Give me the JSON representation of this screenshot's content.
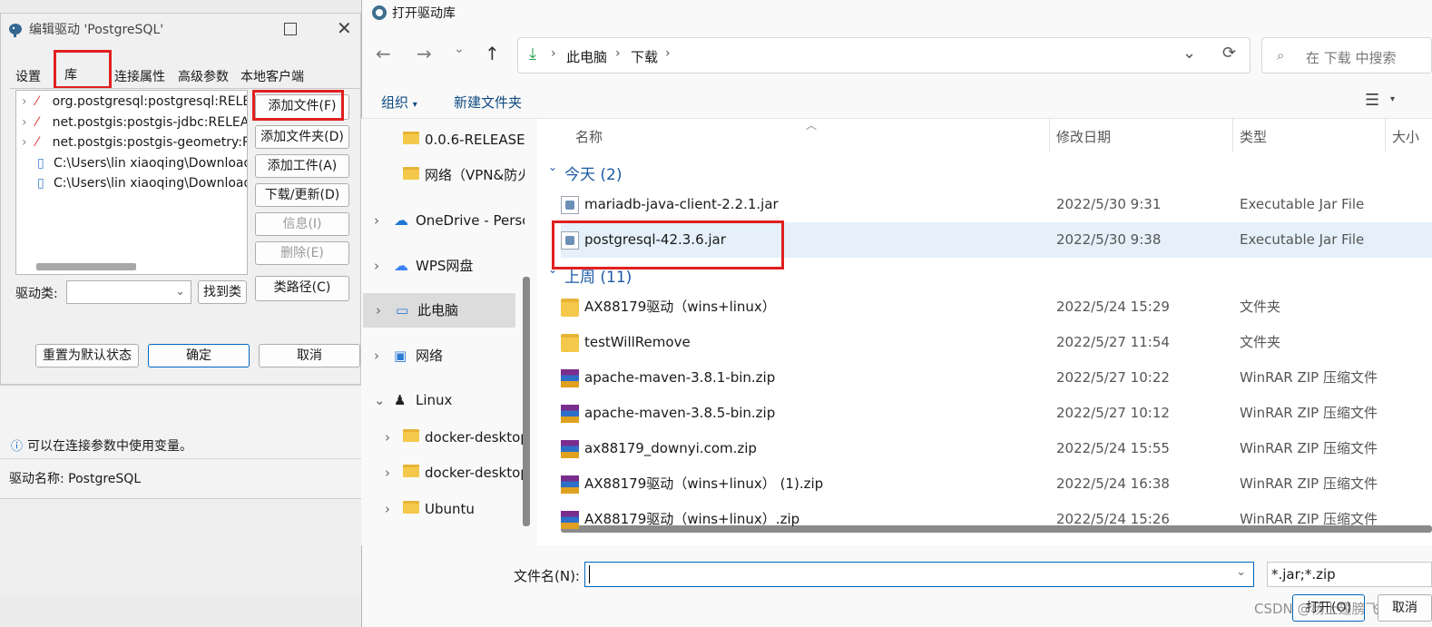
{
  "left": {
    "title": "编辑驱动 'PostgreSQL'",
    "tabs": [
      "设置",
      "库",
      "连接属性",
      "高级参数",
      "本地客户端"
    ],
    "tree": [
      {
        "label": "org.postgresql:postgresql:RELEASE",
        "kind": "maven"
      },
      {
        "label": "net.postgis:postgis-jdbc:RELEASE",
        "kind": "maven"
      },
      {
        "label": "net.postgis:postgis-geometry:RELEASE",
        "kind": "maven"
      },
      {
        "label": "C:\\Users\\lin xiaoqing\\Downloads",
        "kind": "file"
      },
      {
        "label": "C:\\Users\\lin xiaoqing\\Downloads",
        "kind": "file"
      }
    ],
    "buttons": {
      "add_file": "添加文件(F)",
      "add_folder": "添加文件夹(D)",
      "add_artifact": "添加工件(A)",
      "download_update": "下载/更新(D)",
      "info": "信息(I)",
      "delete": "删除(E)",
      "class_path": "类路径(C)",
      "find_class": "找到类",
      "reset_default": "重置为默认状态",
      "ok": "确定",
      "cancel": "取消"
    },
    "driver_class_label": "驱动类:",
    "info_text": "可以在连接参数中使用变量。",
    "driver_name_label": "驱动名称: PostgreSQL"
  },
  "right": {
    "title": "打开驱动库",
    "breadcrumb": [
      "此电脑",
      "下载"
    ],
    "search_placeholder": "在 下载 中搜索",
    "toolbar": {
      "organize": "组织",
      "new_folder": "新建文件夹"
    },
    "nav_items": [
      {
        "label": "0.0.6-RELEASE",
        "icon": "folder",
        "expandable": false
      },
      {
        "label": "网络（VPN&防火墙）",
        "icon": "folder",
        "expandable": false
      },
      {
        "label": "OneDrive - Personal",
        "icon": "onedrive",
        "expandable": true
      },
      {
        "label": "WPS网盘",
        "icon": "cloud",
        "expandable": true
      },
      {
        "label": "此电脑",
        "icon": "computer",
        "expandable": true
      },
      {
        "label": "网络",
        "icon": "network",
        "expandable": true
      },
      {
        "label": "Linux",
        "icon": "linux",
        "expandable": true
      },
      {
        "label": "docker-desktop",
        "icon": "folder",
        "expandable": true
      },
      {
        "label": "docker-desktop-data",
        "icon": "folder",
        "expandable": true
      },
      {
        "label": "Ubuntu",
        "icon": "folder",
        "expandable": true
      }
    ],
    "columns": [
      "名称",
      "修改日期",
      "类型",
      "大小"
    ],
    "group_today": "今天 (2)",
    "group_lastweek": "上周 (11)",
    "files_today": [
      {
        "name": "mariadb-java-client-2.2.1.jar",
        "date": "2022/5/30 9:31",
        "type": "Executable Jar File",
        "icon": "jar"
      },
      {
        "name": "postgresql-42.3.6.jar",
        "date": "2022/5/30 9:38",
        "type": "Executable Jar File",
        "icon": "jar"
      }
    ],
    "files_lastweek": [
      {
        "name": "AX88179驱动（wins+linux）",
        "date": "2022/5/24 15:29",
        "type": "文件夹",
        "icon": "folder"
      },
      {
        "name": "testWillRemove",
        "date": "2022/5/27 11:54",
        "type": "文件夹",
        "icon": "folder"
      },
      {
        "name": "apache-maven-3.8.1-bin.zip",
        "date": "2022/5/27 10:22",
        "type": "WinRAR ZIP 压缩文件",
        "icon": "zip"
      },
      {
        "name": "apache-maven-3.8.5-bin.zip",
        "date": "2022/5/27 10:12",
        "type": "WinRAR ZIP 压缩文件",
        "icon": "zip"
      },
      {
        "name": "ax88179_downyi.com.zip",
        "date": "2022/5/24 15:55",
        "type": "WinRAR ZIP 压缩文件",
        "icon": "zip"
      },
      {
        "name": "AX88179驱动（wins+linux） (1).zip",
        "date": "2022/5/24 16:38",
        "type": "WinRAR ZIP 压缩文件",
        "icon": "zip"
      },
      {
        "name": "AX88179驱动（wins+linux）.zip",
        "date": "2022/5/24 15:26",
        "type": "WinRAR ZIP 压缩文件",
        "icon": "zip"
      }
    ],
    "filename_label": "文件名(N):",
    "filename_value": "",
    "filter_value": "*.jar;*.zip",
    "open_button": "打开(O)",
    "cancel_button": "取消",
    "watermark": "CSDN @杨上翅膀飞"
  },
  "colors": {
    "accent": "#0067c0",
    "highlight": "#e02020",
    "selected_row": "#e5f0fb"
  }
}
